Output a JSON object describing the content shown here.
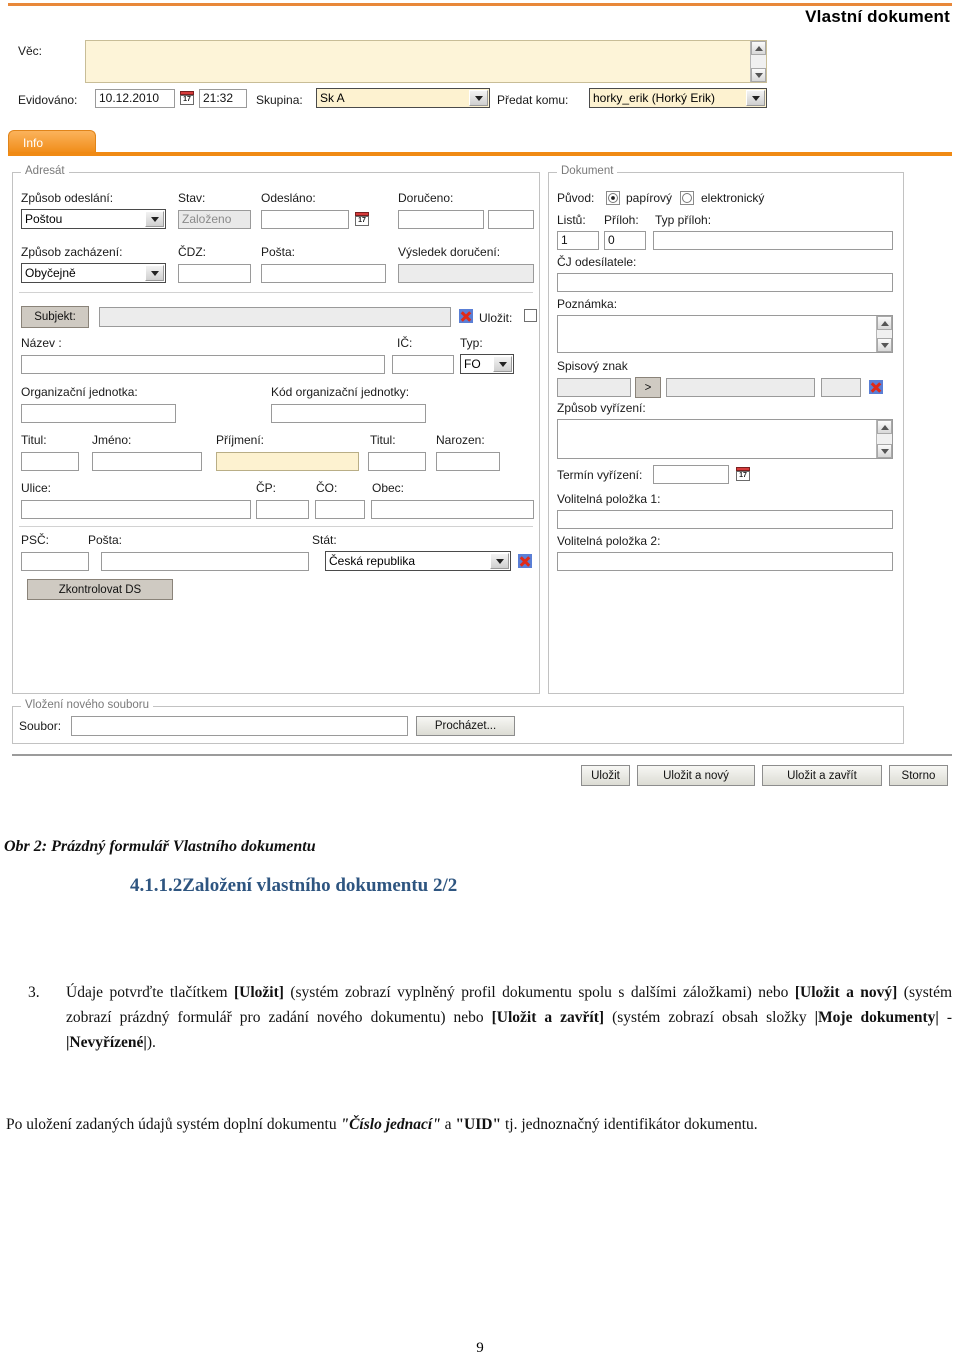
{
  "form": {
    "title": "Vlastní dokument",
    "subject": {
      "label": "Věc:",
      "value": ""
    },
    "registered": {
      "label": "Evidováno:",
      "date": "10.12.2010",
      "time": "21:32",
      "calendar_icon_day": "17"
    },
    "group": {
      "label": "Skupina:",
      "value": "Sk A"
    },
    "handover": {
      "label": "Předat komu:",
      "value": "horky_erik (Horký Erik)"
    },
    "tab": {
      "label": "Info"
    }
  },
  "addressee": {
    "legend": "Adresát",
    "send_method": {
      "label": "Způsob odeslání:",
      "value": "Poštou"
    },
    "state": {
      "label": "Stav:",
      "value": "Založeno"
    },
    "sent": {
      "label": "Odesláno:",
      "value": ""
    },
    "delivered": {
      "label": "Doručeno:",
      "value": "",
      "value2": ""
    },
    "handling_method": {
      "label": "Způsob zacházení:",
      "value": "Obyčejně"
    },
    "cdz": {
      "label": "ČDZ:",
      "value": ""
    },
    "post": {
      "label": "Pošta:",
      "value": ""
    },
    "delivery_result": {
      "label": "Výsledek doručení:",
      "value": ""
    },
    "subject_button": "Subjekt:",
    "subject_value": "",
    "save_label": "Uložit:",
    "name": {
      "label": "Název :",
      "value": ""
    },
    "ico": {
      "label": "IČ:",
      "value": ""
    },
    "type": {
      "label": "Typ:",
      "value": "FO"
    },
    "org_unit": {
      "label": "Organizační jednotka:",
      "value": ""
    },
    "org_unit_code": {
      "label": "Kód organizační jednotky:",
      "value": ""
    },
    "title_pre": {
      "label": "Titul:",
      "value": ""
    },
    "first_name": {
      "label": "Jméno:",
      "value": ""
    },
    "last_name": {
      "label": "Příjmení:",
      "value": ""
    },
    "title_post": {
      "label": "Titul:",
      "value": ""
    },
    "born": {
      "label": "Narozen:",
      "value": ""
    },
    "street": {
      "label": "Ulice:",
      "value": ""
    },
    "cp": {
      "label": "ČP:",
      "value": ""
    },
    "co": {
      "label": "ČO:",
      "value": ""
    },
    "city": {
      "label": "Obec:",
      "value": ""
    },
    "zip": {
      "label": "PSČ:",
      "value": ""
    },
    "post_office": {
      "label": "Pošta:",
      "value": ""
    },
    "country": {
      "label": "Stát:",
      "value": "Česká republika"
    },
    "check_ds_button": "Zkontrolovat DS"
  },
  "document": {
    "legend": "Dokument",
    "origin": {
      "label": "Původ:",
      "option_paper": "papírový",
      "option_electronic": "elektronický",
      "selected": "papírový"
    },
    "sheets": {
      "label": "Listů:",
      "value": "1"
    },
    "attachments": {
      "label": "Příloh:",
      "value": "0"
    },
    "attachment_type": {
      "label": "Typ příloh:",
      "value": ""
    },
    "sender_ref": {
      "label": "ČJ odesílatele:",
      "value": ""
    },
    "note": {
      "label": "Poznámka:",
      "value": ""
    },
    "file_mark": {
      "label": "Spisový znak",
      "value1": "",
      "value2": "",
      "value3": "",
      "browse_button": ">"
    },
    "resolution_method": {
      "label": "Způsob vyřízení:",
      "value": ""
    },
    "deadline": {
      "label": "Termín vyřízení:",
      "value": "",
      "calendar_icon_day": "17"
    },
    "optional1": {
      "label": "Volitelná položka 1:",
      "value": ""
    },
    "optional2": {
      "label": "Volitelná položka 2:",
      "value": ""
    }
  },
  "upload": {
    "legend": "Vložení nového souboru",
    "file": {
      "label": "Soubor:",
      "value": ""
    },
    "browse_button": "Procházet..."
  },
  "actions": {
    "save": "Uložit",
    "save_new": "Uložit a nový",
    "save_close": "Uložit a zavřít",
    "cancel": "Storno"
  },
  "doc": {
    "figure_caption": "Obr 2: Prázdný formulář Vlastního dokumentu",
    "section_heading": "4.1.1.2Založení vlastního dokumentu 2/2",
    "item_number": "3.",
    "p1_a": "Údaje potvrďte tlačítkem ",
    "p1_b1": "[Uložit]",
    "p1_c": " (systém zobrazí vyplněný profil dokumentu spolu s dalšími záložkami) nebo ",
    "p1_b2": "[Uložit a nový]",
    "p1_d": " (systém zobrazí prázdný formulář pro zadání nového dokumentu) nebo ",
    "p1_b3": "[Uložit a zavřít]",
    "p1_e": " (systém zobrazí obsah složky ",
    "p1_b4": "|Moje dokumenty|",
    "p1_f": " - ",
    "p1_b5": "|Nevyřízené|",
    "p1_g": ").",
    "p2_a": "Po uložení zadaných údajů systém doplní dokumentu ",
    "p2_b1": "\"Číslo jednací\"",
    "p2_c": " a ",
    "p2_b2": "\"UID\"",
    "p2_d": " tj. jednoznačný identifikátor dokumentu.",
    "page_number": "9"
  },
  "colors": {
    "accent": "#f08a14",
    "rule": "#e8883a",
    "heading": "#2e5580",
    "highlight": "#fdf2d0"
  }
}
